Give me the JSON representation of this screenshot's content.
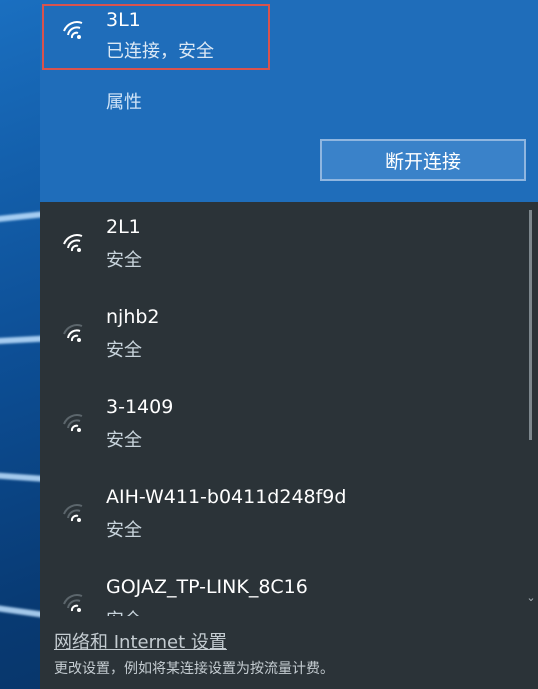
{
  "connected_network": {
    "name": "3L1",
    "status": "已连接，安全",
    "icon": "wifi-signal-icon",
    "properties_link": "属性",
    "disconnect_button": "断开连接"
  },
  "networks": [
    {
      "name": "2L1",
      "status": "安全",
      "icon": "wifi-signal-icon"
    },
    {
      "name": "njhb2",
      "status": "安全",
      "icon": "wifi-signal-icon"
    },
    {
      "name": "3-1409",
      "status": "安全",
      "icon": "wifi-signal-icon"
    },
    {
      "name": "AIH-W411-b0411d248f9d",
      "status": "安全",
      "icon": "wifi-signal-icon"
    },
    {
      "name": "GOJAZ_TP-LINK_8C16",
      "status": "安全",
      "icon": "wifi-signal-icon"
    }
  ],
  "footer": {
    "settings_link": "网络和 Internet 设置",
    "description": "更改设置，例如将某连接设置为按流量计费。"
  },
  "colors": {
    "accent": "#1f6dba",
    "highlight_border": "#d9534f",
    "panel_bg": "#2b3338"
  }
}
